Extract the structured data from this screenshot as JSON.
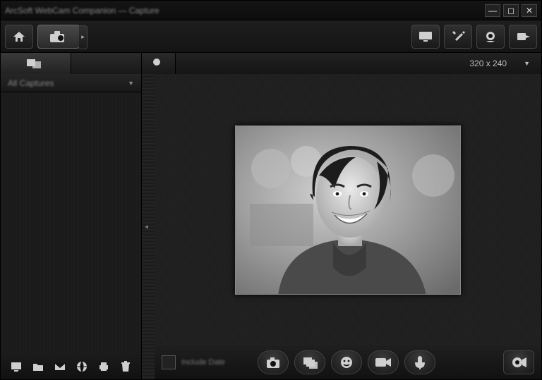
{
  "window": {
    "title": "ArcSoft WebCam Companion — Capture"
  },
  "toolbar": {
    "home": "home",
    "capture": "camera",
    "display": "display",
    "settings": "settings",
    "webcam_settings": "webcam-settings",
    "export": "export"
  },
  "tabs": {
    "media_browser": "media-browser",
    "video_browser": "video-browser",
    "effects": "effects"
  },
  "resolution": {
    "label": "320 x 240",
    "dropdown": "▼"
  },
  "sidebar": {
    "filter_label": "All Captures",
    "filter_dropdown": "▼",
    "tools": {
      "slideshow": "slideshow",
      "open_folder": "open-folder",
      "email": "email",
      "web": "web",
      "print": "print",
      "delete": "delete"
    }
  },
  "bottom": {
    "checkbox_label": "Include Date",
    "camera": "camera",
    "burst": "burst",
    "face": "face",
    "video": "video",
    "mic": "mic",
    "full_preview": "full-preview"
  },
  "winctrl": {
    "min": "—",
    "max": "◻",
    "close": "✕"
  },
  "divider_grip": "◂"
}
